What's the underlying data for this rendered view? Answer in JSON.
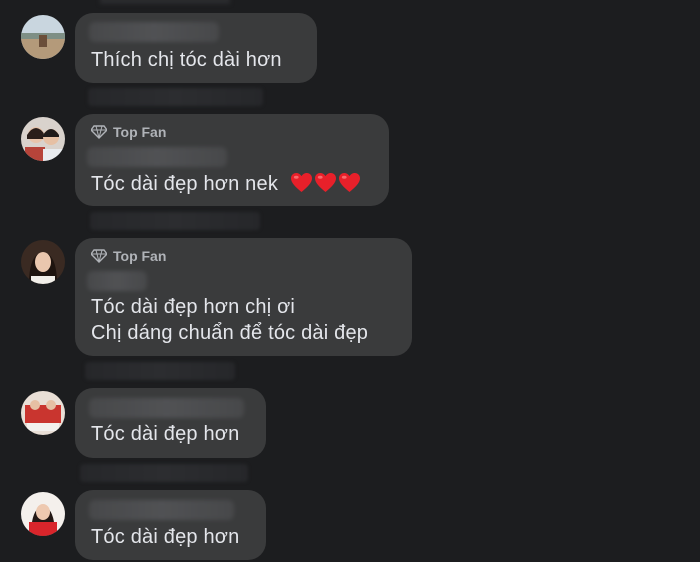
{
  "comments": [
    {
      "badge": "",
      "text_lines": [
        "Thích chị tóc dài hơn"
      ],
      "hearts": 0
    },
    {
      "badge": "Top Fan",
      "text_lines": [
        "Tóc dài đẹp hơn nek"
      ],
      "hearts": 3,
      "heart_icon": "red-heart-emoji"
    },
    {
      "badge": "Top Fan",
      "text_lines": [
        "Tóc dài đẹp hơn chị ơi",
        "Chị dáng chuẩn để tóc dài đẹp"
      ],
      "hearts": 0
    },
    {
      "badge": "",
      "text_lines": [
        "Tóc dài đẹp hơn"
      ],
      "hearts": 0
    },
    {
      "badge": "",
      "text_lines": [
        "Tóc dài đẹp hơn"
      ],
      "hearts": 0
    }
  ],
  "colors": {
    "background": "#1c1d1f",
    "bubble": "#3a3b3c",
    "text": "#e4e6eb",
    "badge_text": "#b0b3b8",
    "heart": "#e8202a"
  },
  "icons": {
    "badge": "diamond-icon"
  }
}
